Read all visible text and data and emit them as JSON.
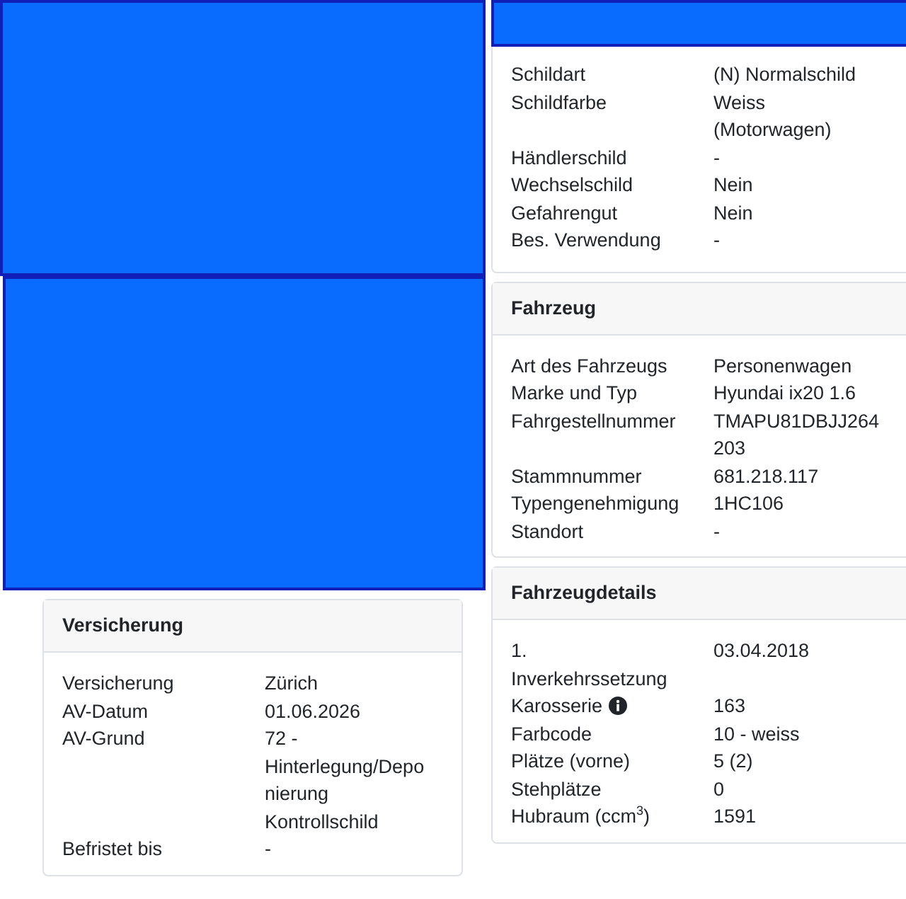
{
  "left_column": [
    {
      "kind": "redaction"
    },
    {
      "kind": "redaction"
    },
    {
      "kind": "card",
      "title": "Versicherung",
      "rows": [
        {
          "label": "Versicherung",
          "value": "Zürich"
        },
        {
          "label": "AV-Datum",
          "value": "01.06.2026"
        },
        {
          "label": "AV-Grund",
          "value": "72 - Hinterlegung/Deponierung Kontrollschild"
        },
        {
          "label": "Befristet bis",
          "value": "-"
        }
      ]
    }
  ],
  "right_column": [
    {
      "kind": "redacted_header",
      "rows": [
        {
          "label": "Schildart",
          "value": "(N) Normalschild"
        },
        {
          "label": "Schildfarbe",
          "value": "Weiss (Motorwagen)"
        },
        {
          "label": "Händlerschild",
          "value": "-"
        },
        {
          "label": "Wechselschild",
          "value": "Nein"
        },
        {
          "label": "Gefahrengut",
          "value": "Nein"
        },
        {
          "label": "Bes. Verwendung",
          "value": "-"
        }
      ]
    },
    {
      "kind": "card",
      "title": "Fahrzeug",
      "rows": [
        {
          "label": "Art des Fahrzeugs",
          "value": "Personenwagen"
        },
        {
          "label": "Marke und Typ",
          "value": "Hyundai ix20 1.6"
        },
        {
          "label": "Fahrgestellnummer",
          "value": "TMAPU81DBJJ264203"
        },
        {
          "label": "Stammnummer",
          "value": "681.218.117"
        },
        {
          "label": "Typengenehmigung",
          "value": "1HC106"
        },
        {
          "label": "Standort",
          "value": "-"
        }
      ]
    },
    {
      "kind": "card",
      "title": "Fahrzeugdetails",
      "rows": [
        {
          "label": "1. Inverkehrssetzung",
          "value": "03.04.2018"
        },
        {
          "label": "Karosserie",
          "value": "163",
          "info": true
        },
        {
          "label": "Farbcode",
          "value": "10 - weiss"
        },
        {
          "label": "Plätze (vorne)",
          "value": "5 (2)"
        },
        {
          "label": "Stehplätze",
          "value": "0"
        },
        {
          "label": "Hubraum (ccm$^{3}$)",
          "value": "1591"
        }
      ]
    }
  ]
}
